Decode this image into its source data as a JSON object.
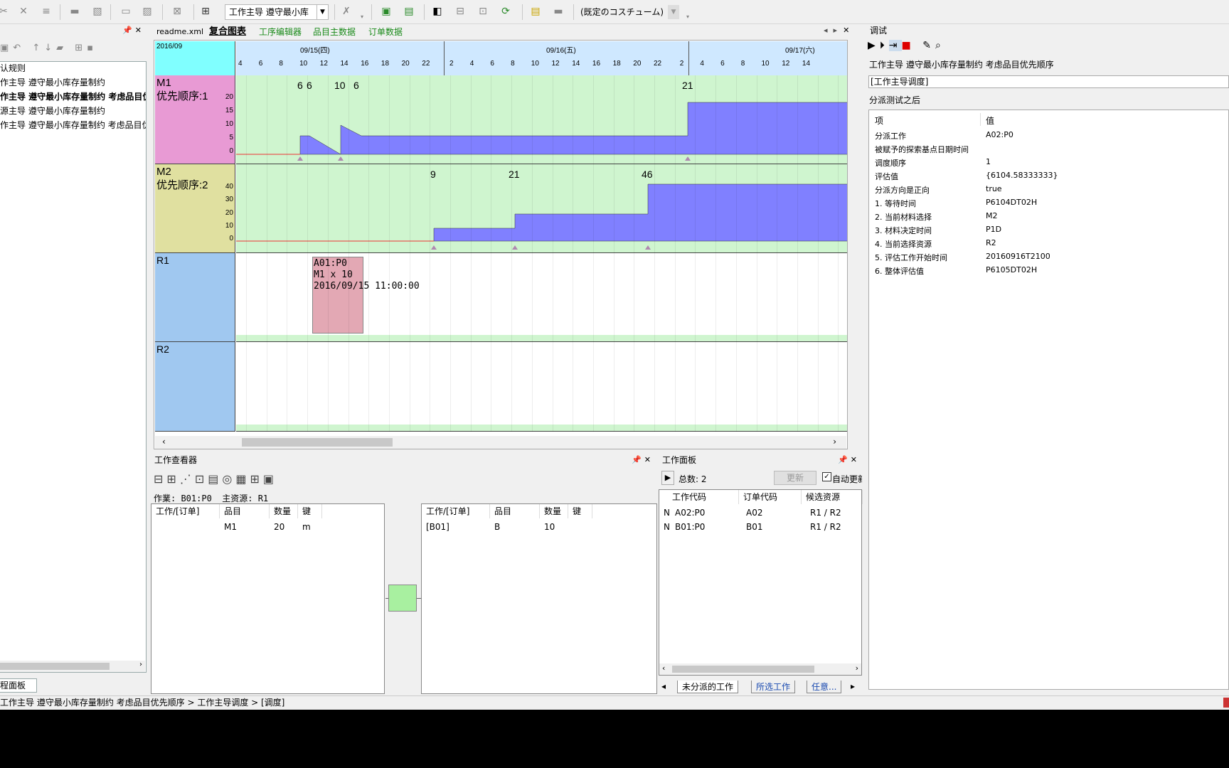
{
  "toolbar": {
    "rule_select": "工作主导 遵守最小库",
    "costume_select": "(既定のコスチューム)"
  },
  "left_panel": {
    "items": [
      "认规则",
      "作主导 遵守最小库存量制约",
      "作主导 遵守最小库存量制约 考虑品目优",
      "源主导 遵守最小库存量制约",
      "作主导 遵守最小库存量制约 考虑品目优"
    ],
    "bottom_tab": "程面板"
  },
  "doc_tabs": {
    "t1": "readme.xml",
    "t2": "复合图表",
    "t3": "工序编辑器",
    "t4": "品目主数据",
    "t5": "订单数据"
  },
  "gantt": {
    "year_month": "2016/09",
    "days": [
      "09/15(四)",
      "09/16(五)",
      "09/17(六)"
    ],
    "hours": [
      "4",
      "6",
      "8",
      "10",
      "12",
      "14",
      "16",
      "18",
      "20",
      "22",
      "2",
      "4",
      "6",
      "8",
      "10",
      "12",
      "14",
      "16",
      "18",
      "20",
      "22",
      "2",
      "4",
      "6",
      "8",
      "10",
      "12",
      "14"
    ],
    "m1": {
      "name": "M1",
      "priority": "优先顺序:1",
      "yticks": [
        "20",
        "15",
        "10",
        "5",
        "0"
      ],
      "events": [
        "6",
        "6",
        "10",
        "6",
        "21"
      ]
    },
    "m2": {
      "name": "M2",
      "priority": "优先顺序:2",
      "yticks": [
        "40",
        "30",
        "20",
        "10",
        "0"
      ],
      "events": [
        "9",
        "21",
        "46"
      ]
    },
    "r1": {
      "name": "R1",
      "job_line1": "A01:P0",
      "job_line2": "M1 x 10",
      "job_line3": "2016/09/15 11:00:00"
    },
    "r2": {
      "name": "R2"
    }
  },
  "debug": {
    "title": "调试",
    "rule_name": "工作主导 遵守最小库存量制约 考虑品目优先顺序",
    "section1": "[工作主导调度]",
    "section2": "分派测试之后",
    "col_item": "项",
    "col_value": "值",
    "rows": [
      {
        "k": "分派工作",
        "v": "A02:P0"
      },
      {
        "k": "被赋予的探索基点日期时间",
        "v": ""
      },
      {
        "k": "调度顺序",
        "v": "1"
      },
      {
        "k": "评估值",
        "v": "{6104.58333333}"
      },
      {
        "k": "分派方向是正向",
        "v": "true"
      },
      {
        "k": "1. 等待时间",
        "v": "P6104DT02H"
      },
      {
        "k": "2. 当前材料选择",
        "v": "M2"
      },
      {
        "k": "3. 材料决定时间",
        "v": "P1D"
      },
      {
        "k": "4. 当前选择资源",
        "v": "R2"
      },
      {
        "k": "5. 评估工作开始时间",
        "v": "20160916T2100"
      },
      {
        "k": "6. 整体评估值",
        "v": "P6105DT02H"
      }
    ]
  },
  "work_viewer": {
    "title": "工作查看器",
    "info": "作業: B01:P0  主资源: R1",
    "left_headers": [
      "工作/[订单]",
      "品目",
      "数量",
      "键"
    ],
    "left_row": [
      "",
      "M1",
      "20",
      "m"
    ],
    "right_headers": [
      "工作/[订单]",
      "品目",
      "数量",
      "键"
    ],
    "right_row": [
      "[B01]",
      "B",
      "10",
      ""
    ]
  },
  "work_panel": {
    "title": "工作面板",
    "total": "总数: 2",
    "update": "更新",
    "auto_update": "自动更新",
    "headers": [
      "工作代码",
      "订单代码",
      "候选资源"
    ],
    "rows": [
      [
        "N",
        "A02:P0",
        "A02",
        "R1 / R2"
      ],
      [
        "N",
        "B01:P0",
        "B01",
        "R1 / R2"
      ]
    ],
    "tabs": [
      "未分派的工作",
      "所选工作",
      "任意..."
    ]
  },
  "status": "工作主导 遵守最小库存量制约 考虑品目优先顺序 > 工作主导调度 > [调度]",
  "colors": {
    "m1_label": "#e89ad4",
    "m2_label": "#e0e0a0",
    "res_label": "#a0c8f0",
    "chart_bg": "#cff5cf",
    "bar": "#8080ff",
    "job": "#e3a8b4",
    "header": "#80ffff"
  }
}
